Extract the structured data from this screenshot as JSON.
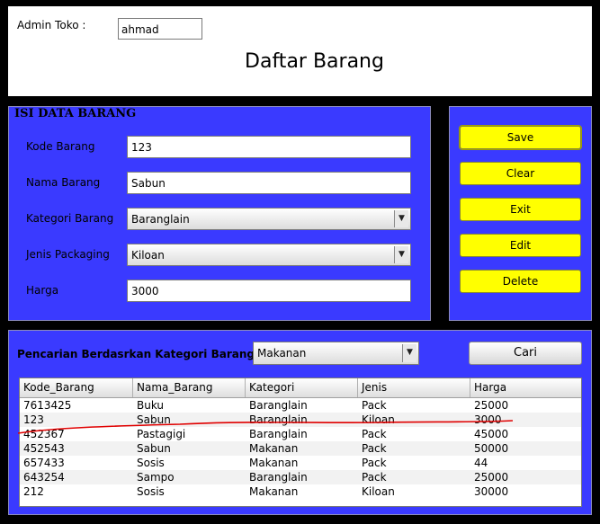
{
  "header": {
    "admin_label": "Admin Toko :",
    "admin_value": "ahmad",
    "title": "Daftar Barang"
  },
  "form": {
    "title": "ISI DATA BARANG",
    "fields": [
      {
        "label": "Kode Barang",
        "value": "123",
        "type": "text"
      },
      {
        "label": "Nama Barang",
        "value": "Sabun",
        "type": "text"
      },
      {
        "label": "Kategori Barang",
        "value": "Baranglain",
        "type": "select"
      },
      {
        "label": "Jenis Packaging",
        "value": "Kiloan",
        "type": "select"
      },
      {
        "label": "Harga",
        "value": "3000",
        "type": "text"
      }
    ]
  },
  "buttons": {
    "save": "Save",
    "clear": "Clear",
    "exit": "Exit",
    "edit": "Edit",
    "delete": "Delete"
  },
  "search": {
    "label": "Pencarian Berdasrkan Kategori Barang",
    "category": "Makanan",
    "button": "Cari"
  },
  "table": {
    "columns": [
      "Kode_Barang",
      "Nama_Barang",
      "Kategori",
      "Jenis",
      "Harga"
    ],
    "rows": [
      [
        "7613425",
        "Buku",
        "Baranglain",
        "Pack",
        "25000"
      ],
      [
        "123",
        "Sabun",
        "Baranglain",
        "Kiloan",
        "3000"
      ],
      [
        "452367",
        "Pastagigi",
        "Baranglain",
        "Pack",
        "45000"
      ],
      [
        "452543",
        "Sabun",
        "Makanan",
        "Pack",
        "50000"
      ],
      [
        "657433",
        "Sosis",
        "Makanan",
        "Pack",
        "44"
      ],
      [
        "643254",
        "Sampo",
        "Baranglain",
        "Pack",
        "25000"
      ],
      [
        "212",
        "Sosis",
        "Makanan",
        "Kiloan",
        "30000"
      ]
    ]
  },
  "colors": {
    "panel": "#3a3aff",
    "button_yellow": "#ffff00",
    "annotation_red": "#e00000"
  },
  "icons": {
    "dropdown": "chevron-down-icon"
  }
}
